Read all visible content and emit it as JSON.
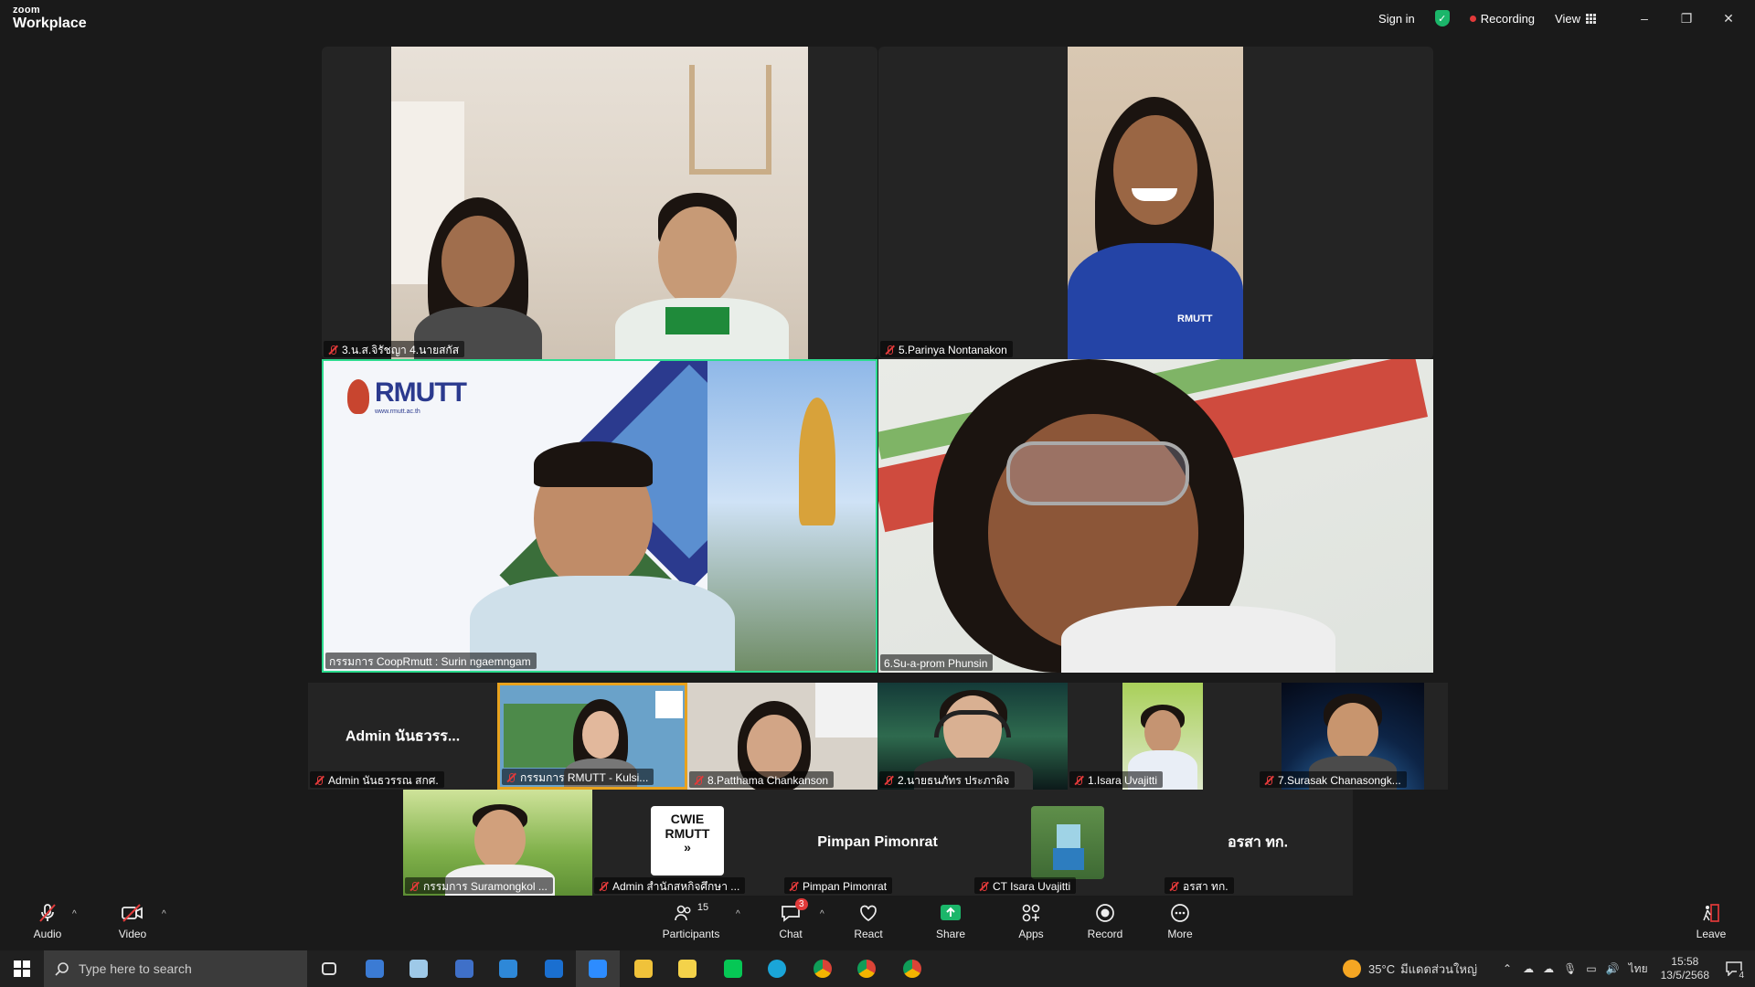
{
  "app": {
    "logo_top": "zoom",
    "logo_bottom": "Workplace"
  },
  "titlebar": {
    "sign_in": "Sign in",
    "recording": "Recording",
    "view": "View",
    "minimize": "–",
    "restore": "❐",
    "close": "✕"
  },
  "tiles": {
    "t1": "3.น.ส.จิรัชญา 4.นายสกัส",
    "t2": "5.Parinya Nontanakon",
    "t3": "กรรมการ CoopRmutt : Surin ngaemngam",
    "t4": "6.Su-a-prom Phunsin",
    "rmutt_logo": "RMUTT",
    "rmutt_sub": "www.rmutt.ac.th",
    "shirt_text": "RMUTT"
  },
  "row1": [
    {
      "big": "Admin นันธวรร...",
      "name": "Admin นันธวรรณ สกศ."
    },
    {
      "name": "กรรมการ RMUTT - Kulsi..."
    },
    {
      "name": "8.Patthama Chankanson"
    },
    {
      "name": "2.นายธนภัทร ประภาผิจ"
    },
    {
      "name": "1.Isara Uvajitti"
    },
    {
      "name": "7.Surasak Chanasongk..."
    }
  ],
  "row2": [
    {
      "name": "กรรมการ Suramongkol ..."
    },
    {
      "name": "Admin สำนักสหกิจศึกษา ...",
      "card_line1": "CWIE",
      "card_line2": "RMUTT",
      "card_arrow": "»"
    },
    {
      "big": "Pimpan Pimonrat",
      "name": "Pimpan Pimonrat"
    },
    {
      "name": "CT Isara Uvajitti"
    },
    {
      "big": "อรสา  ทก.",
      "name": "อรสา  ทก."
    }
  ],
  "toolbar": {
    "audio": "Audio",
    "video": "Video",
    "participants": "Participants",
    "participants_count": "15",
    "chat": "Chat",
    "chat_badge": "3",
    "react": "React",
    "share": "Share",
    "apps": "Apps",
    "record": "Record",
    "more": "More",
    "leave": "Leave",
    "caret": "^"
  },
  "taskbar": {
    "search_placeholder": "Type here to search",
    "weather_temp": "35°C",
    "weather_text": "มีแดดส่วนใหญ่",
    "lang": "ไทย",
    "time": "15:58",
    "date": "13/5/2568",
    "notif_count": "4"
  },
  "colors": {
    "active_border": "#2ddc8f",
    "mute_red": "#e23a3a",
    "share_green": "#1bb66a",
    "rmutt_blue": "#2b3a8e"
  }
}
